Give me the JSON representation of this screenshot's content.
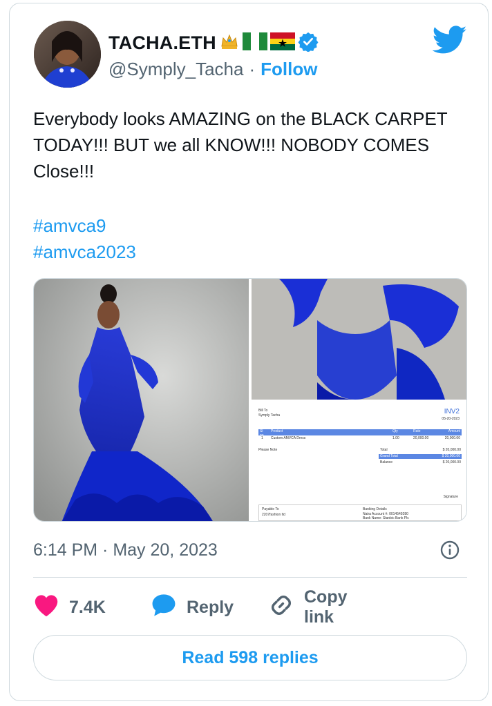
{
  "author": {
    "display_name": "TACHA.ETH",
    "handle": "@Symply_Tacha",
    "separator": "·",
    "follow_label": "Follow"
  },
  "tweet": {
    "text": "Everybody looks AMAZING on the BLACK CARPET TODAY!!!  BUT we all KNOW!!! NOBODY COMES Close!!!",
    "hashtags": [
      "#amvca9",
      "#amvca2023"
    ],
    "timestamp": "6:14 PM · May 20, 2023"
  },
  "invoice": {
    "bill_to_label": "Bill To",
    "bill_to": "Symply Tacha",
    "number": "INV2",
    "date": "05-20-2023",
    "headers": [
      "Sl no.",
      "Product",
      "Qty",
      "Rate",
      "Amount"
    ],
    "row": [
      "1",
      "Custom AMVCA Dress",
      "1.00",
      "20,000.00",
      "20,000.00"
    ],
    "please_note": "Please Note",
    "total_label": "Total",
    "total": "$ 20,000.00",
    "grand_total_label": "Grand Total",
    "grand_total": "$ 20,000.00",
    "balance_label": "Balance",
    "balance": "$ 20,000.00",
    "signature": "Signature",
    "payable_to_label": "Payable To",
    "payable_to": "2207fashion ltd",
    "banking_label": "Banking Details",
    "account": "Naira Account #: 0014549280",
    "bank": "Bank Name: Stanbic Bank Plc"
  },
  "actions": {
    "likes": "7.4K",
    "reply_label": "Reply",
    "copy_label": "Copy link",
    "read_replies_label": "Read 598 replies"
  },
  "colors": {
    "accent": "#1d9bf0",
    "like": "#f91880",
    "text": "#0f1419",
    "muted": "#536471"
  },
  "icons": [
    "crown-icon",
    "nigeria-flag-icon",
    "ghana-flag-icon",
    "verified-badge-icon",
    "twitter-bird-icon",
    "info-icon",
    "heart-icon",
    "reply-bubble-icon",
    "link-icon"
  ]
}
